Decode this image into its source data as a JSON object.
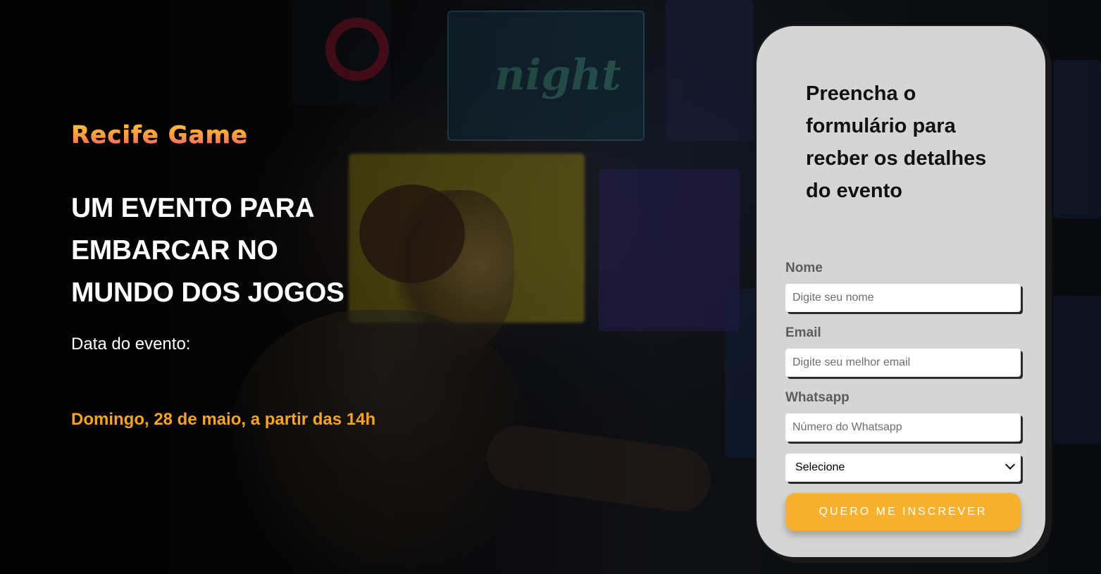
{
  "brand": {
    "logo_text": "Recife Game"
  },
  "hero": {
    "headline_lines": [
      "UM EVENTO PARA",
      "EMBARCAR NO",
      "MUNDO DOS JOGOS"
    ],
    "date_label": "Data do evento:",
    "date_value": "Domingo, 28 de maio, a partir das 14h"
  },
  "form": {
    "title": "Preencha o formulário para recber os detalhes do evento",
    "fields": {
      "name": {
        "label": "Nome",
        "placeholder": "Digite seu nome"
      },
      "email": {
        "label": "Email",
        "placeholder": "Digite seu melhor email"
      },
      "whatsapp": {
        "label": "Whatsapp",
        "placeholder": "Número do Whatsapp"
      }
    },
    "select": {
      "selected": "Selecione"
    },
    "submit_label": "Quero me inscrever"
  },
  "colors": {
    "accent": "#f7a420",
    "button": "#f7b12e",
    "card_bg": "#d5d5d5",
    "background": "#050505"
  },
  "icons": {
    "select_arrow": "chevron-down-icon"
  }
}
